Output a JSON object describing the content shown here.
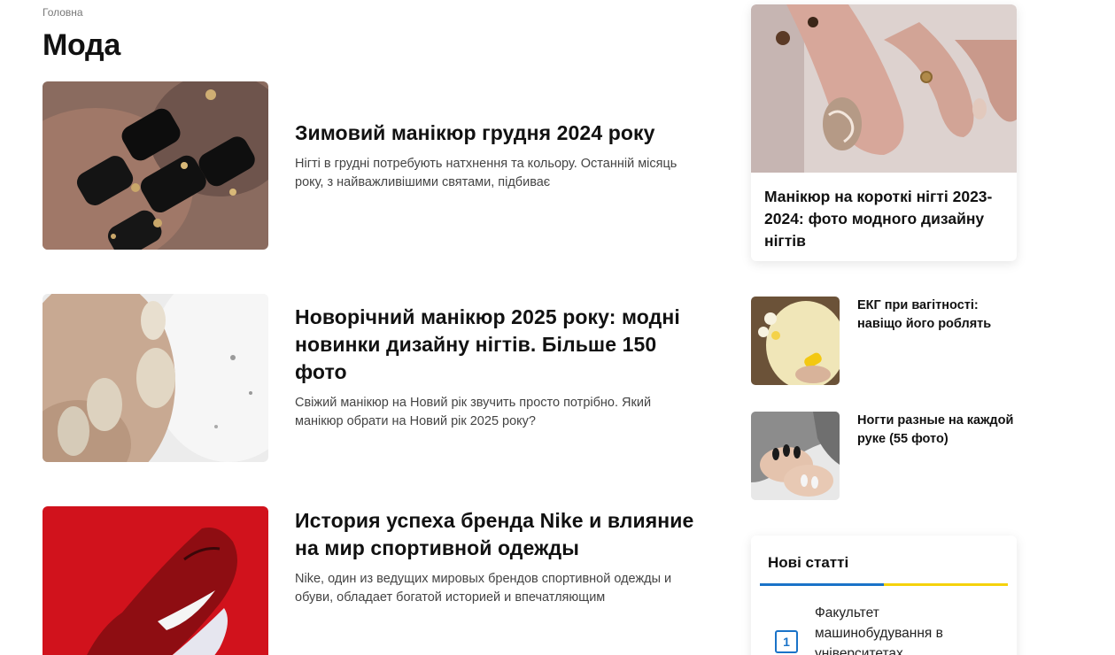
{
  "breadcrumb": {
    "home": "Головна"
  },
  "page": {
    "title": "Мода"
  },
  "articles": [
    {
      "title": "Зимовий манікюр грудня 2024 року",
      "excerpt": "Нігті в грудні потребують натхнення та кольору. Останній місяць року, з найважливішими святами, підбиває",
      "image": "black-gold-nails-photo"
    },
    {
      "title": "Новорічний манікюр 2025 року: модні новинки дизайну нігтів. Більше 150 фото",
      "excerpt": "Свіжий манікюр на Новий рік звучить просто потрібно. Який манікюр обрати на Новий рік 2025 року?",
      "image": "pearl-white-nails-photo"
    },
    {
      "title": "История успеха бренда Nike и влияние на мир спортивной одежды",
      "excerpt": "Nike, один из ведущих мировых брендов спортивной одежды и обуви, обладает богатой историей и впечатляющим",
      "image": "red-nike-sneaker-photo"
    }
  ],
  "sidebar": {
    "featured": {
      "title": "Манікюр на короткі нігті 2023-2024: фото модного дизайну нігтів",
      "image": "short-nails-swirl-photo"
    },
    "mini_articles": [
      {
        "title": "ЕКГ при вагітності: навіщо його роблять",
        "image": "pregnancy-photo"
      },
      {
        "title": "Ногти разные на каждой руке (55 фото)",
        "image": "mismatched-nails-photo"
      }
    ],
    "new_articles": {
      "heading": "Нові статті",
      "items": [
        {
          "number": "1",
          "title": "Факультет машинобудування в університетах"
        }
      ]
    }
  },
  "colors": {
    "accent_blue": "#1a73c8",
    "accent_yellow": "#f5d20c",
    "text_dark": "#111111",
    "text_muted": "#444444"
  }
}
